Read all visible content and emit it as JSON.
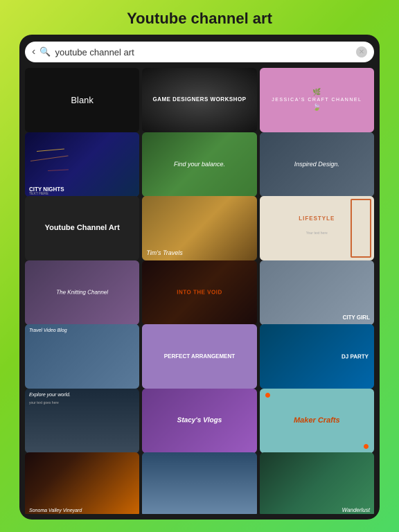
{
  "page": {
    "title": "Youtube channel art",
    "search_placeholder": "youtube channel art"
  },
  "tiles": [
    {
      "id": "blank",
      "label": "Blank"
    },
    {
      "id": "game",
      "label": "Game Designers Workshop"
    },
    {
      "id": "jessica",
      "label": "Jessica's Craft Channel"
    },
    {
      "id": "city-nights",
      "label": "City Nights",
      "sub": "Text here"
    },
    {
      "id": "balance",
      "label": "Find your balance."
    },
    {
      "id": "inspired",
      "label": "Inspired Design."
    },
    {
      "id": "yt-channel",
      "label": "Youtube Channel Art"
    },
    {
      "id": "tims",
      "label": "Tim's Travels"
    },
    {
      "id": "lifestyle",
      "label": "Lifestyle",
      "sub": "Your text here"
    },
    {
      "id": "knitting",
      "label": "The Knitting Channel"
    },
    {
      "id": "void",
      "label": "Into The Void"
    },
    {
      "id": "city-girl",
      "label": "City Girl"
    },
    {
      "id": "travel-blog",
      "label": "Travel Video Blog"
    },
    {
      "id": "perfect",
      "label": "Perfect Arrangement"
    },
    {
      "id": "dj",
      "label": "DJ Party"
    },
    {
      "id": "explore",
      "label": "Explore your world.",
      "sub": "your text goes here"
    },
    {
      "id": "stacy",
      "label": "Stacy's Vlogs"
    },
    {
      "id": "maker",
      "label": "Maker Crafts"
    },
    {
      "id": "sonoma",
      "label": "Sonoma Valley Vineyard"
    },
    {
      "id": "mountain",
      "label": ""
    },
    {
      "id": "wanderlust",
      "label": "Wanderlust"
    }
  ]
}
